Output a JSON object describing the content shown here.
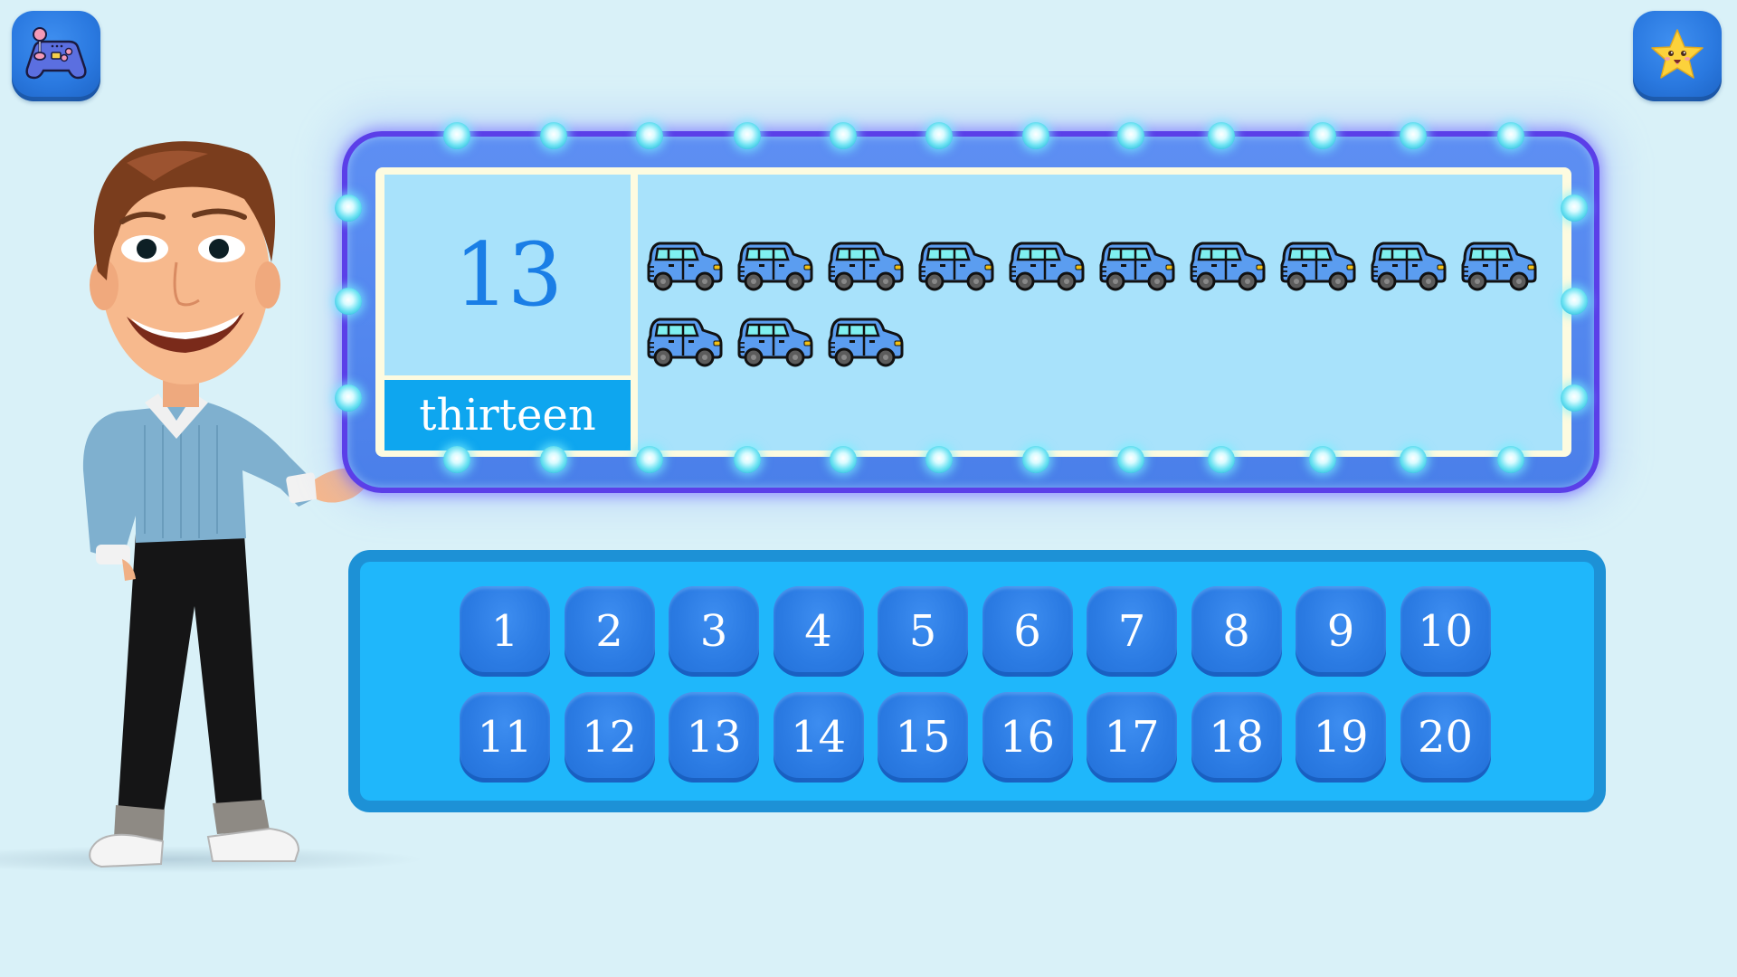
{
  "toolbar": {
    "games_button": {
      "icon": "gamepad-icon",
      "label": "Games"
    },
    "rewards_button": {
      "icon": "smiling-star-icon",
      "label": "Stars"
    }
  },
  "lesson": {
    "number": "13",
    "number_word": "thirteen",
    "object_icon": "blue-car-icon",
    "object_count": 13
  },
  "answer_options": [
    "1",
    "2",
    "3",
    "4",
    "5",
    "6",
    "7",
    "8",
    "9",
    "10",
    "11",
    "12",
    "13",
    "14",
    "15",
    "16",
    "17",
    "18",
    "19",
    "20"
  ],
  "colors": {
    "background": "#d9f1f8",
    "board_cell": "#a8e2fb",
    "number_text": "#1a7ee6",
    "word_band": "#0ea6ef",
    "answer_panel": "#1fb7fb",
    "answer_panel_border": "#1d91d6",
    "answer_button": "#2b7be3",
    "car_body": "#5b9df0",
    "car_window": "#7ff0f0"
  }
}
